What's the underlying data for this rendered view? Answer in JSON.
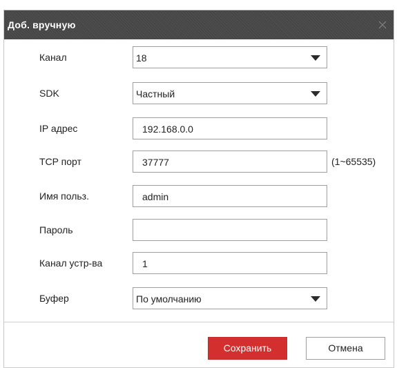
{
  "dialog": {
    "title": "Доб. вручную",
    "close_icon": "close-icon"
  },
  "form": {
    "channel": {
      "label": "Канал",
      "value": "18"
    },
    "sdk": {
      "label": "SDK",
      "value": "Частный"
    },
    "ip": {
      "label": "IP адрес",
      "value": "192.168.0.0"
    },
    "tcp_port": {
      "label": "TCP порт",
      "value": "37777",
      "hint": "(1~65535)"
    },
    "username": {
      "label": "Имя польз.",
      "value": "admin"
    },
    "password": {
      "label": "Пароль",
      "value": ""
    },
    "device_channel": {
      "label": "Канал устр-ва",
      "value": "1"
    },
    "buffer": {
      "label": "Буфер",
      "value": "По умолчанию"
    }
  },
  "buttons": {
    "save": "Сохранить",
    "cancel": "Отмена"
  },
  "colors": {
    "titlebar": "#4a4a4a",
    "save_button": "#d32f2f",
    "border": "#9f9f9f"
  }
}
